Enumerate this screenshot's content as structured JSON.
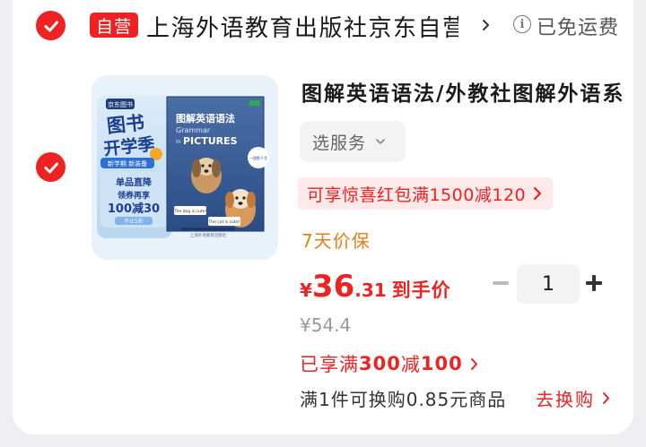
{
  "store": {
    "badge": "自营",
    "name": "上海外语教育出版社京东自营官方旗舰店",
    "shipping": "已免运费"
  },
  "product": {
    "title": "图解英语语法/外教社图解外语系列",
    "service_select": "选服务",
    "coupon": "可享惊喜红包满1500减120",
    "price_protect": "7天价保",
    "price": {
      "currency": "¥",
      "integer": "36",
      "decimal": ".31",
      "label": "到手价"
    },
    "quantity": "1",
    "original_price": "¥54.4",
    "promo": {
      "prefix": "已享满",
      "num1": "300",
      "mid": "减",
      "num2": "100"
    },
    "exchange_text": "满1件可换购0.85元商品",
    "exchange_link": "去换购"
  },
  "cover": {
    "badge": "京东图书",
    "headline1": "图书",
    "headline2": "开学季",
    "tags": "新学期 新装备",
    "deal1": "单品直降",
    "deal2": "领券再享",
    "deal3": "100减30",
    "deal4": "不止5折",
    "book_title": "图解英语语法",
    "book_en1": "Grammar",
    "book_en2": "in",
    "book_en3": "PICTURES",
    "bubble1": "The dog is cute!",
    "bubble2": "The cat is cute!",
    "sticker": "一图胜千言",
    "publisher": "上海外语教育出版社"
  },
  "colors": {
    "accent": "#ee2222",
    "warning": "#e0801a",
    "muted": "#999999"
  }
}
